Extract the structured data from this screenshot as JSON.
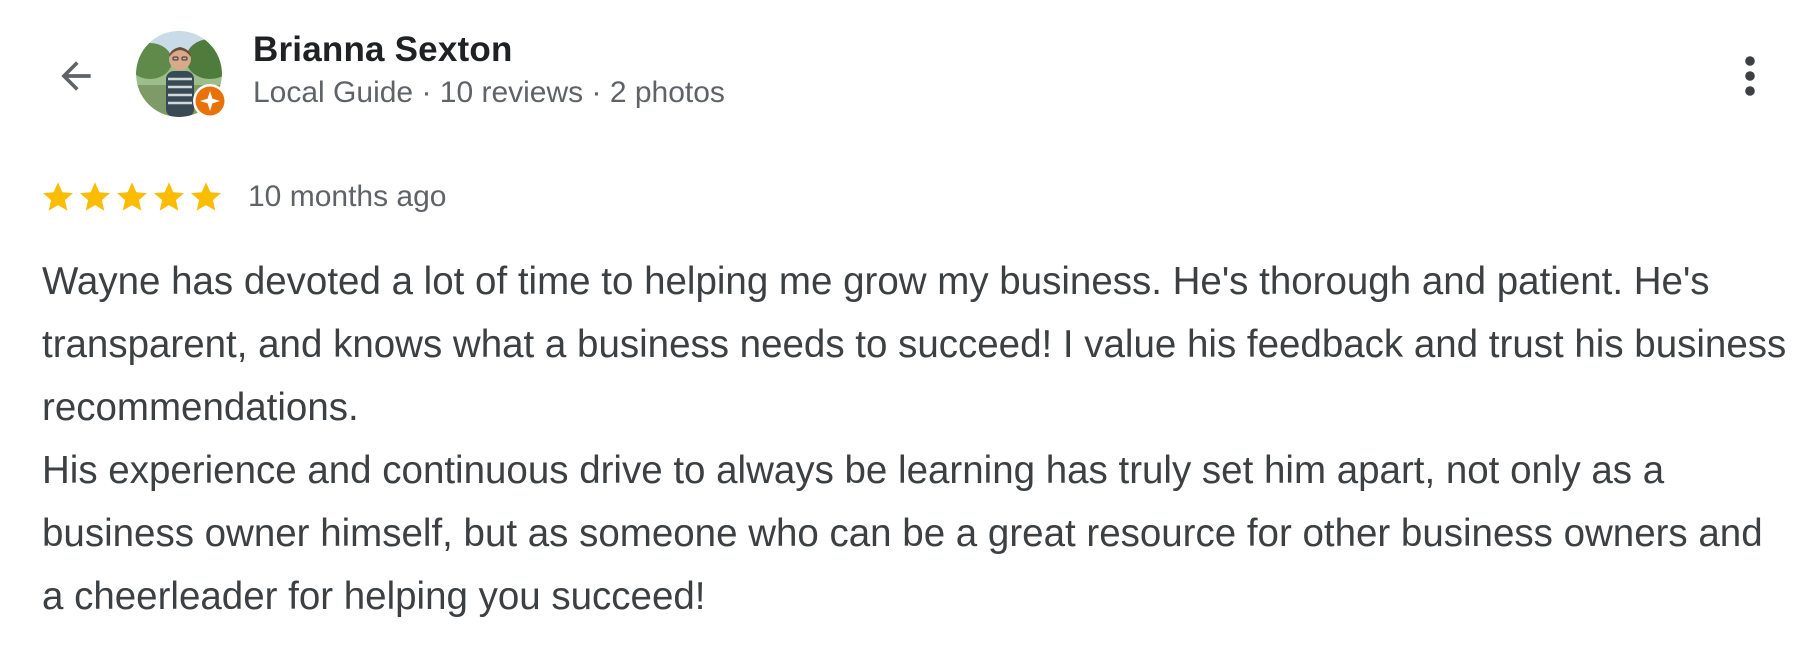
{
  "reviewer": {
    "name": "Brianna Sexton",
    "meta": "Local Guide · 10 reviews · 2 photos"
  },
  "icons": {
    "back": "arrow-back-icon",
    "more": "more-vert-icon",
    "guide_badge": "local-guide-badge-icon",
    "star": "star-icon"
  },
  "colors": {
    "star": "#FBBC04",
    "badge": "#E8710A",
    "name": "#202124",
    "secondary": "#5f6368",
    "body": "#3c4043"
  },
  "review": {
    "rating": 5,
    "rating_max": 5,
    "time_ago": "10 months ago",
    "paragraphs": [
      "Wayne has devoted a lot of time to helping me grow my business. He's thorough and patient. He's transparent, and knows what a business needs to succeed! I value his feedback and trust his business recommendations.",
      "His experience and continuous drive to always be learning has truly set him apart, not only as a business owner himself, but as someone who can be a great resource for other business owners and a cheerleader for helping you succeed!"
    ]
  }
}
